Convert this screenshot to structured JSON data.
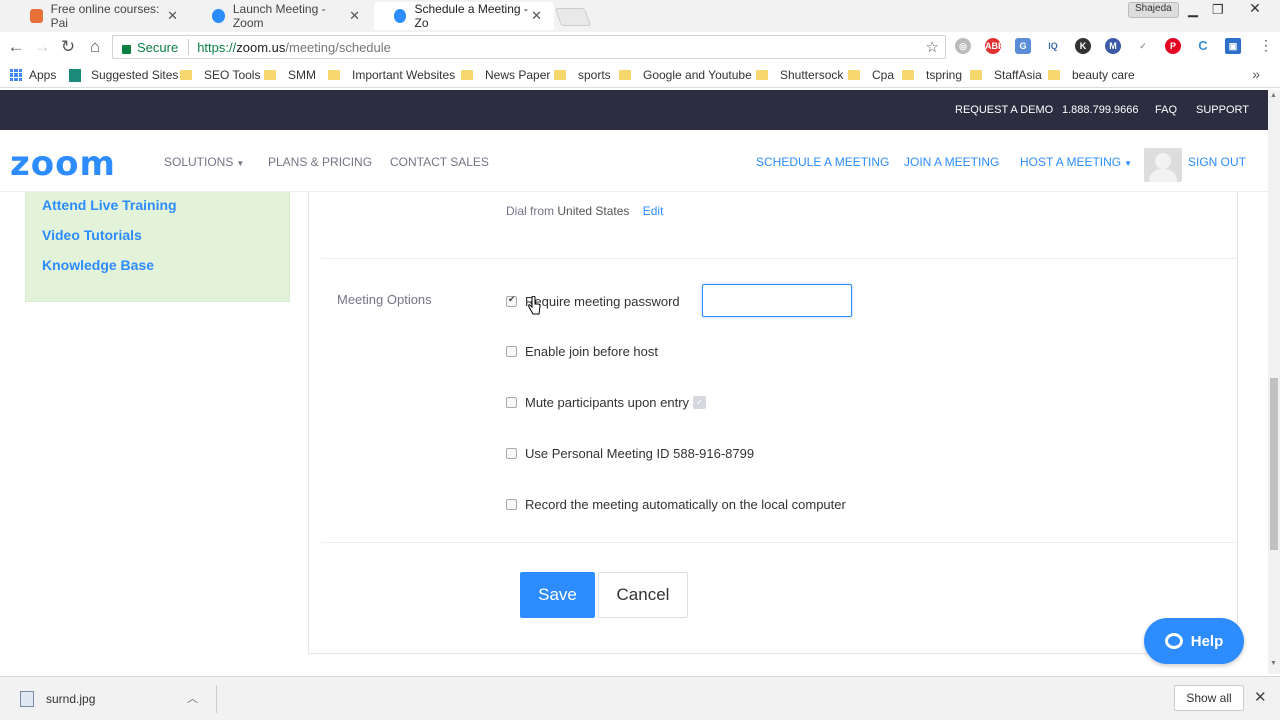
{
  "browser": {
    "tabs": [
      {
        "title": "Free online courses: Pai",
        "favicon_color": "#e8713a"
      },
      {
        "title": "Launch Meeting - Zoom",
        "favicon_color": "#2d8cff"
      },
      {
        "title": "Schedule a Meeting - Zo",
        "favicon_color": "#2d8cff"
      }
    ],
    "user_badge": "Shajeda",
    "secure_label": "Secure",
    "url_proto": "https://",
    "url_host": "zoom.us",
    "url_path": "/meeting/schedule",
    "bookmarks": [
      "Apps",
      "Suggested Sites",
      "SEO Tools",
      "SMM",
      "Important Websites",
      "News Paper",
      "sports",
      "Google and Youtube",
      "Shuttersock",
      "Cpa",
      "tspring",
      "StaffAsia",
      "beauty care"
    ],
    "more_bookmarks": "»"
  },
  "site": {
    "topbar": {
      "request_demo": "REQUEST A DEMO",
      "phone": "1.888.799.9666",
      "faq": "FAQ",
      "support": "SUPPORT"
    },
    "logo": "zoom",
    "nav_left": {
      "solutions": "SOLUTIONS",
      "plans": "PLANS & PRICING",
      "contact": "CONTACT SALES"
    },
    "nav_right": {
      "schedule": "SCHEDULE A MEETING",
      "join": "JOIN A MEETING",
      "host": "HOST A MEETING",
      "signout": "SIGN OUT"
    },
    "sidebar": [
      "Attend Live Training",
      "Video Tutorials",
      "Knowledge Base"
    ],
    "dial": {
      "prefix": "Dial from",
      "country": "United States",
      "edit": "Edit"
    },
    "meeting_options_label": "Meeting Options",
    "options": [
      {
        "label": "Require meeting password",
        "checked": true
      },
      {
        "label": "Enable join before host",
        "checked": false
      },
      {
        "label": "Mute participants upon entry",
        "checked": false
      },
      {
        "label": "Use Personal Meeting ID 588-916-8799",
        "checked": false
      },
      {
        "label": "Record the meeting automatically on the local computer",
        "checked": false
      }
    ],
    "password_value": "",
    "save_label": "Save",
    "cancel_label": "Cancel",
    "help_label": "Help",
    "accent_color": "#2d8cff"
  },
  "downloads": {
    "file": "surnd.jpg",
    "show_all": "Show all"
  }
}
